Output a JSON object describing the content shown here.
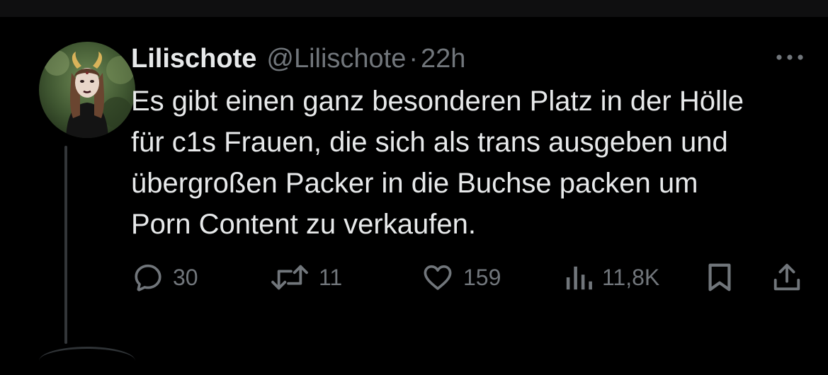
{
  "post": {
    "display_name": "Lilischote",
    "handle": "@Lilischote",
    "separator": "·",
    "time": "22h",
    "text": "Es gibt einen ganz besonderen Platz in der Hölle\nfür c1s Frauen, die sich als trans ausgeben und\nübergroßen Packer in die Buchse packen um\nPorn Content zu verkaufen."
  },
  "actions": {
    "reply": {
      "icon": "reply-icon",
      "count": "30"
    },
    "repost": {
      "icon": "repost-icon",
      "count": "11"
    },
    "like": {
      "icon": "heart-icon",
      "count": "159"
    },
    "views": {
      "icon": "views-icon",
      "count": "11,8K"
    },
    "bookmark": {
      "icon": "bookmark-icon"
    },
    "share": {
      "icon": "share-icon"
    }
  },
  "menu": {
    "icon": "more-icon"
  },
  "colors": {
    "background": "#000000",
    "primary_text": "#e7e9ea",
    "secondary_text": "#71767b",
    "thread_line": "#333639"
  }
}
